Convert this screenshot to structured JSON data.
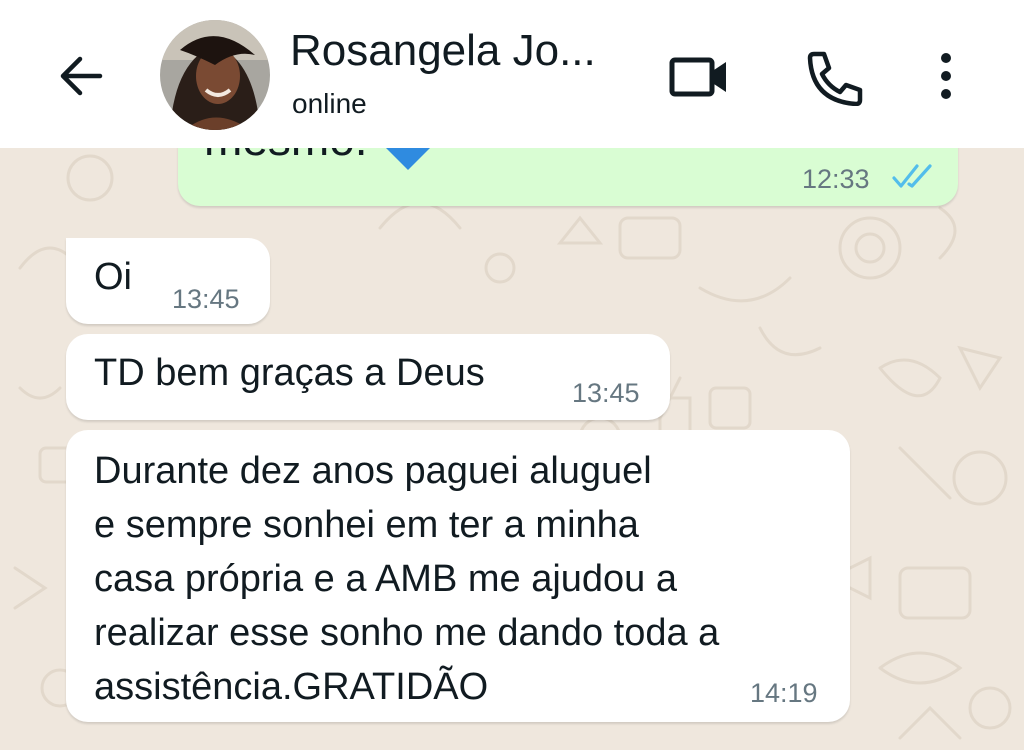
{
  "header": {
    "contact_name": "Rosangela Jo...",
    "status": "online",
    "icons": [
      "back-arrow-icon",
      "video-call-icon",
      "voice-call-icon",
      "more-options-icon"
    ]
  },
  "messages": [
    {
      "direction": "outgoing",
      "text": "mesmo. ",
      "emoji": "blue-heart",
      "time": "12:33",
      "status": "read"
    },
    {
      "direction": "incoming",
      "text": "Oi",
      "time": "13:45"
    },
    {
      "direction": "incoming",
      "text": "TD bem graças a Deus",
      "time": "13:45"
    },
    {
      "direction": "incoming",
      "lines": [
        "Durante dez anos paguei aluguel",
        "e sempre sonhei em ter a minha",
        "casa própria e a AMB me ajudou a",
        "realizar esse sonho me dando toda a",
        "assistência.GRATIDÃO"
      ],
      "time": "14:19"
    }
  ],
  "colors": {
    "header_bg": "#ffffff",
    "chat_bg": "#efe7dd",
    "outgoing_bubble": "#d9fdd3",
    "incoming_bubble": "#ffffff",
    "read_ticks": "#53bdeb",
    "text": "#111b21",
    "time": "#667781"
  }
}
